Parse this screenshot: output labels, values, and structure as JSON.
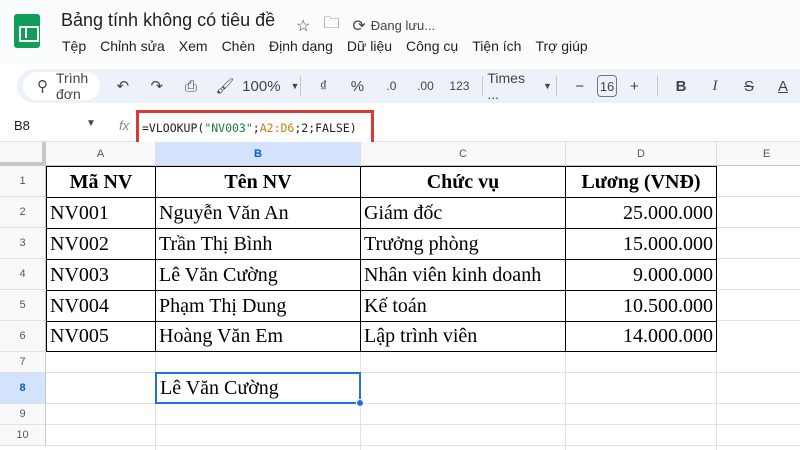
{
  "doc": {
    "title": "Bảng tính không có tiêu đề",
    "status": "Đang lưu..."
  },
  "menu": [
    "Tệp",
    "Chỉnh sửa",
    "Xem",
    "Chèn",
    "Định dạng",
    "Dữ liệu",
    "Công cụ",
    "Tiện ích",
    "Trợ giúp"
  ],
  "toolbar": {
    "search_label": "Trình đơn",
    "zoom": "100%",
    "currency": "₫",
    "percent": "%",
    "dec_decrease": ".0",
    "dec_increase": ".00",
    "number_format": "123",
    "font": "Times ...",
    "font_size": "16",
    "minus": "−",
    "plus": "+",
    "bold": "B",
    "italic": "I",
    "strike": "S",
    "text_color": "A"
  },
  "formula_bar": {
    "name_box": "B8",
    "fx": "fx",
    "formula_parts": {
      "p1": "=VLOOKUP(",
      "p2": "\"NV003\"",
      "p3": ";",
      "p4": "A2:D6",
      "p5": ";2;FALSE)"
    }
  },
  "columns": [
    "A",
    "B",
    "C",
    "D",
    "E"
  ],
  "rows": [
    "1",
    "2",
    "3",
    "4",
    "5",
    "6",
    "7",
    "8",
    "9",
    "10"
  ],
  "table": {
    "headers": [
      "Mã NV",
      "Tên NV",
      "Chức vụ",
      "Lương (VNĐ)"
    ],
    "rows": [
      [
        "NV001",
        "Nguyễn Văn An",
        "Giám đốc",
        "25.000.000"
      ],
      [
        "NV002",
        "Trần Thị Bình",
        "Trưởng phòng",
        "15.000.000"
      ],
      [
        "NV003",
        "Lê Văn Cường",
        "Nhân viên kinh doanh",
        "9.000.000"
      ],
      [
        "NV004",
        "Phạm Thị Dung",
        "Kế toán",
        "10.500.000"
      ],
      [
        "NV005",
        "Hoàng Văn Em",
        "Lập trình viên",
        "14.000.000"
      ]
    ]
  },
  "result_cell": {
    "ref": "B8",
    "value": "Lê Văn Cường"
  },
  "colors": {
    "accent": "#1a73e8",
    "highlight_border": "#d83b33",
    "logo": "#0f9d58"
  }
}
